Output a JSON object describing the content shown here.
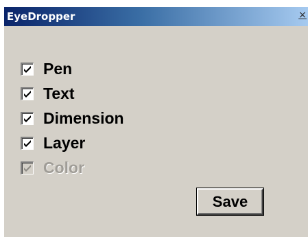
{
  "window": {
    "title": "EyeDropper",
    "close_glyph": "×"
  },
  "options": [
    {
      "label": "Pen",
      "checked": true,
      "enabled": true
    },
    {
      "label": "Text",
      "checked": true,
      "enabled": true
    },
    {
      "label": "Dimension",
      "checked": true,
      "enabled": true
    },
    {
      "label": "Layer",
      "checked": true,
      "enabled": true
    },
    {
      "label": "Color",
      "checked": true,
      "enabled": false
    }
  ],
  "buttons": {
    "save_label": "Save"
  },
  "colors": {
    "titlebar_start": "#0a246a",
    "titlebar_end": "#a6caf0",
    "dialog_face": "#d4d0c8",
    "disabled_text": "#a09d97"
  }
}
